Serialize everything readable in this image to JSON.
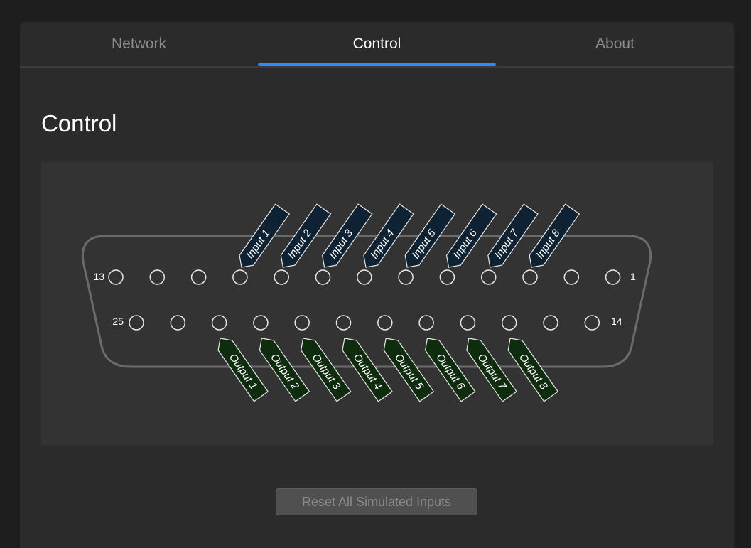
{
  "tabs": [
    {
      "label": "Network"
    },
    {
      "label": "Control"
    },
    {
      "label": "About"
    }
  ],
  "active_tab": "Control",
  "page_title": "Control",
  "colors": {
    "accent": "#2a8cff",
    "input_tag": "#0f2233",
    "output_tag": "#0f2c0f"
  },
  "connector": {
    "top_row_labels": {
      "left": "13",
      "right": "1"
    },
    "bottom_row_labels": {
      "left": "25",
      "right": "14"
    },
    "top_row_pin_count": 13,
    "bottom_row_pin_count": 12,
    "inputs": [
      "Input 1",
      "Input 2",
      "Input 3",
      "Input 4",
      "Input 5",
      "Input 6",
      "Input 7",
      "Input 8"
    ],
    "outputs": [
      "Output 1",
      "Output 2",
      "Output 3",
      "Output 4",
      "Output 5",
      "Output 6",
      "Output 7",
      "Output 8"
    ]
  },
  "reset_button": {
    "label": "Reset All Simulated Inputs",
    "enabled": false
  }
}
